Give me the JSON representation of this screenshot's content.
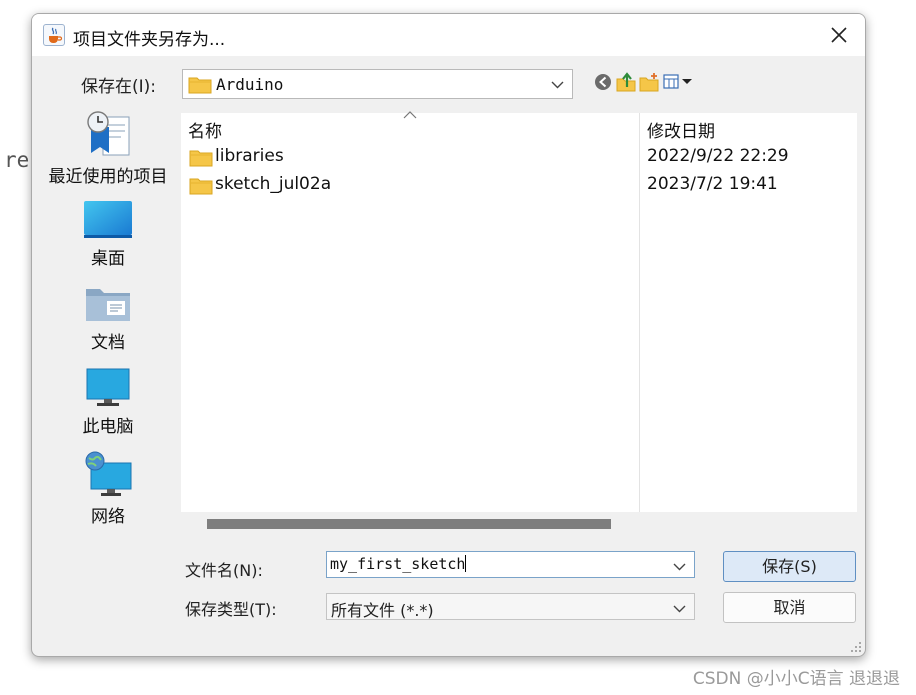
{
  "background": {
    "fragment": "re",
    "watermark": "CSDN @小小C语言 退退退"
  },
  "dialog": {
    "title": "项目文件夹另存为...",
    "close_icon": "close-icon",
    "save_in_label": "保存在(I):",
    "save_in_value": "Arduino",
    "toolbar": [
      "back-icon",
      "up-folder-icon",
      "new-folder-icon",
      "view-menu-icon"
    ]
  },
  "places": [
    {
      "label": "最近使用的项目",
      "icon": "recent-items-icon"
    },
    {
      "label": "桌面",
      "icon": "desktop-icon"
    },
    {
      "label": "文档",
      "icon": "documents-icon"
    },
    {
      "label": "此电脑",
      "icon": "this-pc-icon"
    },
    {
      "label": "网络",
      "icon": "network-icon"
    }
  ],
  "file_list": {
    "columns": {
      "name": "名称",
      "modified": "修改日期"
    },
    "rows": [
      {
        "name": "libraries",
        "modified": "2022/9/22 22:29"
      },
      {
        "name": "sketch_jul02a",
        "modified": "2023/7/2 19:41"
      }
    ]
  },
  "form": {
    "filename_label": "文件名(N):",
    "filename_value": "my_first_sketch",
    "filetype_label": "保存类型(T):",
    "filetype_value": "所有文件 (*.*)",
    "save_button": "保存(S)",
    "cancel_button": "取消"
  },
  "colors": {
    "accent": "#5f8fc2",
    "folder": "#f5c648",
    "scroll_thumb": "#7e7e7e"
  }
}
